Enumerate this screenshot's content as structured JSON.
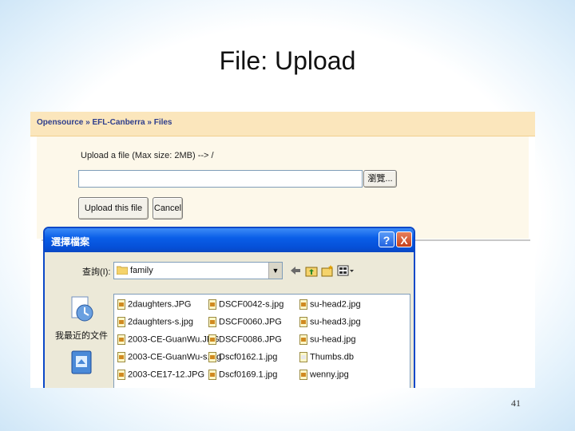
{
  "slide": {
    "title": "File: Upload",
    "page_number": "41"
  },
  "web": {
    "breadcrumb": "Opensource » EFL-Canberra » Files",
    "upload_label": "Upload a file (Max size: 2MB) --> /",
    "browse_label": "瀏覽...",
    "upload_button": "Upload this file",
    "cancel_button": "Cancel"
  },
  "dialog": {
    "title": "選擇檔案",
    "help": "?",
    "close": "X",
    "look_in_label": "查詢(I):",
    "folder": "family",
    "places": [
      "我最近的文件"
    ],
    "files": [
      {
        "name": "2daughters.JPG",
        "type": "img"
      },
      {
        "name": "2daughters-s.jpg",
        "type": "img"
      },
      {
        "name": "2003-CE-GuanWu.JPG",
        "type": "img"
      },
      {
        "name": "2003-CE-GuanWu-s.jpg",
        "type": "img"
      },
      {
        "name": "2003-CE17-12.JPG",
        "type": "img"
      },
      {
        "name": "DSCF0042-s.jpg",
        "type": "img"
      },
      {
        "name": "DSCF0060.JPG",
        "type": "img"
      },
      {
        "name": "DSCF0086.JPG",
        "type": "img"
      },
      {
        "name": "Dscf0162.1.jpg",
        "type": "img"
      },
      {
        "name": "Dscf0169.1.jpg",
        "type": "img"
      },
      {
        "name": "su-head2.jpg",
        "type": "img"
      },
      {
        "name": "su-head3.jpg",
        "type": "img"
      },
      {
        "name": "su-head.jpg",
        "type": "img"
      },
      {
        "name": "Thumbs.db",
        "type": "doc"
      },
      {
        "name": "wenny.jpg",
        "type": "img"
      }
    ]
  }
}
